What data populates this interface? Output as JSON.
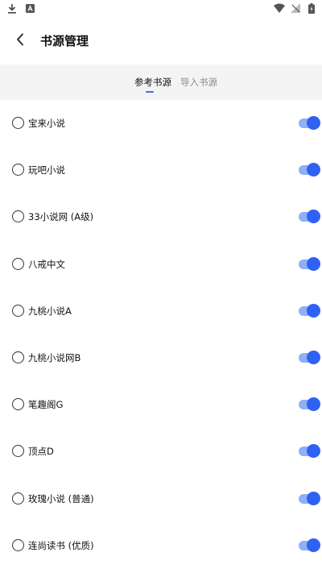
{
  "status_bar": {
    "left_icons": [
      "download-icon",
      "a-notification-icon"
    ],
    "right_icons": [
      "wifi-icon",
      "signal-off-icon",
      "battery-icon"
    ]
  },
  "header": {
    "back_icon": "chevron-left-icon",
    "title": "书源管理"
  },
  "tabs": [
    {
      "label": "参考书源",
      "active": true
    },
    {
      "label": "导入书源",
      "active": false
    }
  ],
  "accent_color": "#2f62f3",
  "sources": [
    {
      "name": "宝来小说",
      "enabled": true
    },
    {
      "name": "玩吧小说",
      "enabled": true
    },
    {
      "name": "33小说网 (A级)",
      "enabled": true
    },
    {
      "name": "八戒中文",
      "enabled": true
    },
    {
      "name": "九桃小说A",
      "enabled": true
    },
    {
      "name": "九桃小说网B",
      "enabled": true
    },
    {
      "name": "笔趣阁G",
      "enabled": true
    },
    {
      "name": "顶点D",
      "enabled": true
    },
    {
      "name": "玫瑰小说 (普通)",
      "enabled": true
    },
    {
      "name": "连尚读书 (优质)",
      "enabled": true
    }
  ]
}
